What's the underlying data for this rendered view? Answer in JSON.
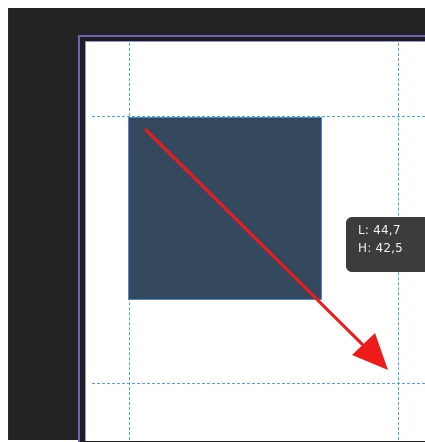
{
  "tooltip": {
    "line1": "L: 44,7",
    "line2": "H: 42,5"
  },
  "colors": {
    "background": "#232323",
    "artboard_border": "#6d66b5",
    "guide": "#4aa6df",
    "shape_fill": "#34495e",
    "shape_border": "#4f8ac7",
    "arrow": "#ee1b1b",
    "tooltip_bg": "#3c3c3c"
  },
  "icons": {
    "arrow": "arrow-annotation-icon"
  }
}
